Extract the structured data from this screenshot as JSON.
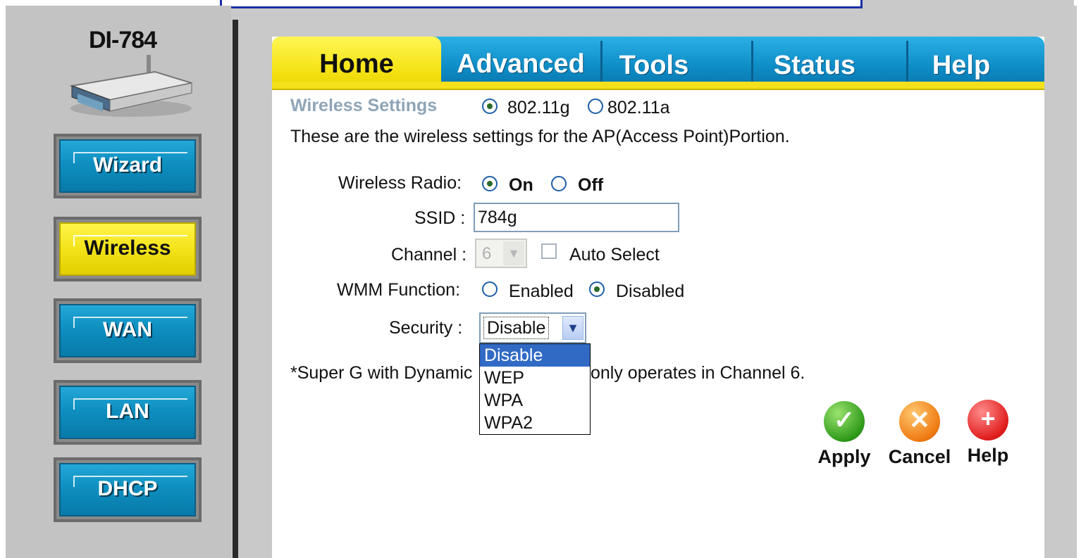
{
  "sidebar": {
    "model": "DI-784",
    "buttons": [
      {
        "label": "Wizard",
        "active": false
      },
      {
        "label": "Wireless",
        "active": true
      },
      {
        "label": "WAN",
        "active": false
      },
      {
        "label": "LAN",
        "active": false
      },
      {
        "label": "DHCP",
        "active": false
      }
    ]
  },
  "tabs": [
    "Home",
    "Advanced",
    "Tools",
    "Status",
    "Help"
  ],
  "active_tab": "Home",
  "content": {
    "section_title": "Wireless Settings",
    "band_options": [
      "802.11g",
      "802.11a"
    ],
    "band_selected": "802.11g",
    "description": "These are the wireless settings for the AP(Access Point)Portion.",
    "radio_label": "Wireless Radio:",
    "radio_on": "On",
    "radio_off": "Off",
    "ssid_label": "SSID :",
    "ssid_value": "784g",
    "channel_label": "Channel :",
    "channel_value": "6",
    "auto_select_label": "Auto Select",
    "wmm_label": "WMM Function:",
    "wmm_enabled": "Enabled",
    "wmm_disabled": "Disabled",
    "security_label": "Security :",
    "security_value": "Disable",
    "security_options": [
      "Disable",
      "WEP",
      "WPA",
      "WPA2"
    ],
    "note_left": "*Super G with Dynamic",
    "note_right": "only operates in Channel 6."
  },
  "actions": {
    "apply": "Apply",
    "cancel": "Cancel",
    "help": "Help"
  },
  "colors": {
    "accent_yellow": "#f4e01b",
    "accent_blue": "#0e8cc6",
    "section_title": "#8fa5b8",
    "dropdown_highlight": "#316ac5"
  }
}
